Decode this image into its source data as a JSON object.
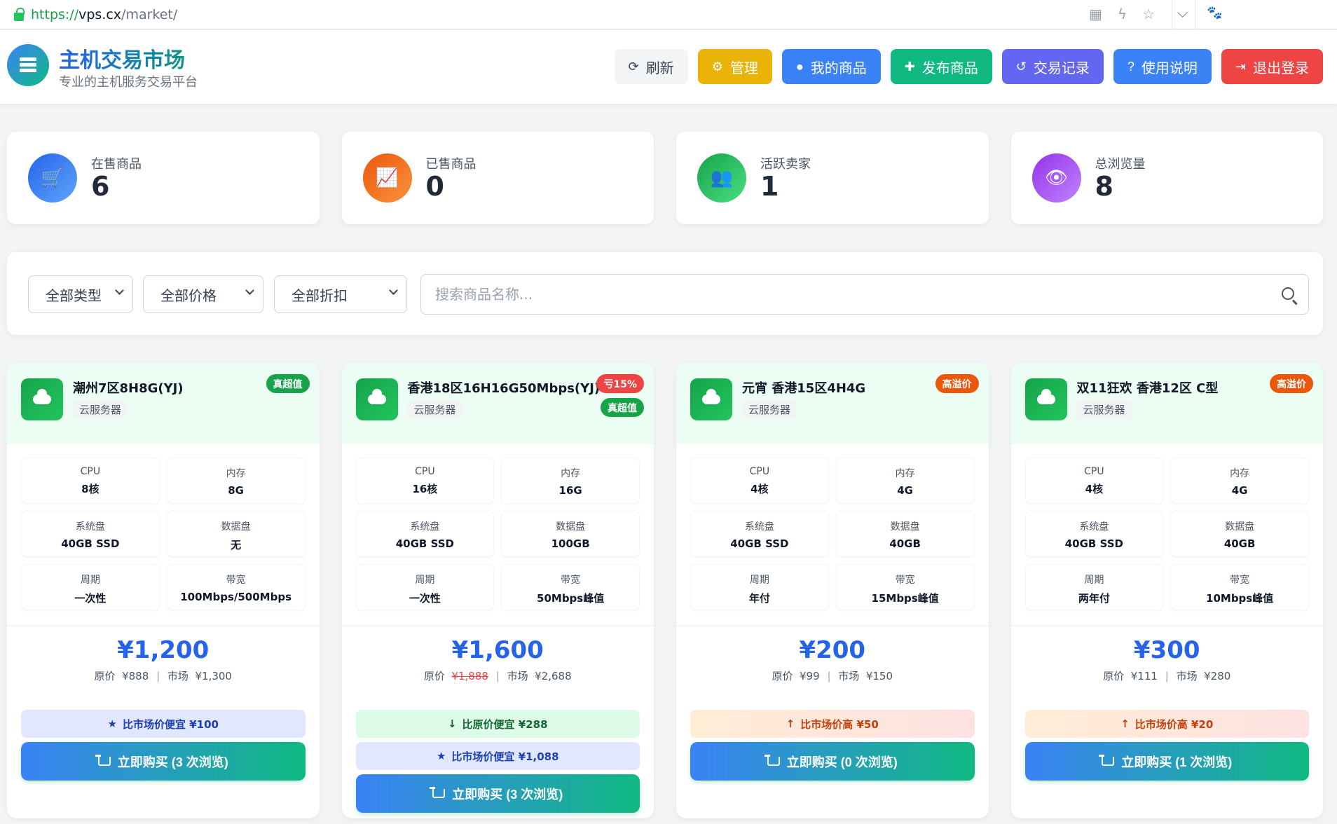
{
  "browser": {
    "url_protocol": "https://",
    "url_host": "vps.cx",
    "url_path": "/market/"
  },
  "header": {
    "title": "主机交易市场",
    "subtitle": "专业的主机服务交易平台",
    "nav": [
      {
        "label": "刷新",
        "icon": "refresh-icon",
        "color": "#f3f4f6"
      },
      {
        "label": "管理",
        "icon": "gear-icon",
        "color": "#eab308"
      },
      {
        "label": "我的商品",
        "icon": "user-icon",
        "color": "#3b82f6"
      },
      {
        "label": "发布商品",
        "icon": "plus-icon",
        "color": "#10b981"
      },
      {
        "label": "交易记录",
        "icon": "history-icon",
        "color": "#6366f1"
      },
      {
        "label": "使用说明",
        "icon": "question-icon",
        "color": "#3b82f6"
      },
      {
        "label": "退出登录",
        "icon": "logout-icon",
        "color": "#ef4444"
      }
    ]
  },
  "stats": [
    {
      "label": "在售商品",
      "value": "6",
      "icon": "cart-icon"
    },
    {
      "label": "已售商品",
      "value": "0",
      "icon": "chart-icon"
    },
    {
      "label": "活跃卖家",
      "value": "1",
      "icon": "users-icon"
    },
    {
      "label": "总浏览量",
      "value": "8",
      "icon": "eye-icon"
    }
  ],
  "filters": {
    "type": "全部类型",
    "price": "全部价格",
    "discount": "全部折扣",
    "search_placeholder": "搜索商品名称..."
  },
  "products": [
    {
      "title": "潮州7区8H8G(YJ)",
      "type": "云服务器",
      "badges": [
        {
          "text": "真超值",
          "color": "#16a34a"
        }
      ],
      "specs": [
        {
          "label": "CPU",
          "value": "8核"
        },
        {
          "label": "内存",
          "value": "8G"
        },
        {
          "label": "系统盘",
          "value": "40GB SSD"
        },
        {
          "label": "数据盘",
          "value": "无"
        },
        {
          "label": "周期",
          "value": "一次性"
        },
        {
          "label": "带宽",
          "value": "100Mbps/500Mbps"
        }
      ],
      "price": "¥1,200",
      "original_label": "原价",
      "original": "¥888",
      "original_struck": false,
      "market_label": "市场",
      "market": "¥1,300",
      "compares": [
        {
          "text": "比市场价便宜 ¥100",
          "icon": "star-icon",
          "style": "blue"
        }
      ],
      "buy_label": "立即购买 (3 次浏览)"
    },
    {
      "title": "香港18区16H16G50Mbps(YJ)",
      "type": "云服务器",
      "badges": [
        {
          "text": "亏15%",
          "color": "#ef4444"
        },
        {
          "text": "真超值",
          "color": "#16a34a"
        }
      ],
      "specs": [
        {
          "label": "CPU",
          "value": "16核"
        },
        {
          "label": "内存",
          "value": "16G"
        },
        {
          "label": "系统盘",
          "value": "40GB SSD"
        },
        {
          "label": "数据盘",
          "value": "100GB"
        },
        {
          "label": "周期",
          "value": "一次性"
        },
        {
          "label": "带宽",
          "value": "50Mbps峰值"
        }
      ],
      "price": "¥1,600",
      "original_label": "原价",
      "original": "¥1,888",
      "original_struck": true,
      "market_label": "市场",
      "market": "¥2,688",
      "compares": [
        {
          "text": "比原价便宜 ¥288",
          "icon": "arrow-down-icon",
          "style": "green"
        },
        {
          "text": "比市场价便宜 ¥1,088",
          "icon": "star-icon",
          "style": "blue"
        }
      ],
      "buy_label": "立即购买 (3 次浏览)"
    },
    {
      "title": "元宵 香港15区4H4G",
      "type": "云服务器",
      "badges": [
        {
          "text": "高溢价",
          "color": "#ea580c"
        }
      ],
      "specs": [
        {
          "label": "CPU",
          "value": "4核"
        },
        {
          "label": "内存",
          "value": "4G"
        },
        {
          "label": "系统盘",
          "value": "40GB SSD"
        },
        {
          "label": "数据盘",
          "value": "40GB"
        },
        {
          "label": "周期",
          "value": "年付"
        },
        {
          "label": "带宽",
          "value": "15Mbps峰值"
        }
      ],
      "price": "¥200",
      "original_label": "原价",
      "original": "¥99",
      "original_struck": false,
      "market_label": "市场",
      "market": "¥150",
      "compares": [
        {
          "text": "比市场价高 ¥50",
          "icon": "arrow-up-icon",
          "style": "orange"
        }
      ],
      "buy_label": "立即购买 (0 次浏览)"
    },
    {
      "title": "双11狂欢 香港12区 C型",
      "type": "云服务器",
      "badges": [
        {
          "text": "高溢价",
          "color": "#ea580c"
        }
      ],
      "specs": [
        {
          "label": "CPU",
          "value": "4核"
        },
        {
          "label": "内存",
          "value": "4G"
        },
        {
          "label": "系统盘",
          "value": "40GB SSD"
        },
        {
          "label": "数据盘",
          "value": "40GB"
        },
        {
          "label": "周期",
          "value": "两年付"
        },
        {
          "label": "带宽",
          "value": "10Mbps峰值"
        }
      ],
      "price": "¥300",
      "original_label": "原价",
      "original": "¥111",
      "original_struck": false,
      "market_label": "市场",
      "market": "¥280",
      "compares": [
        {
          "text": "比市场价高 ¥20",
          "icon": "arrow-up-icon",
          "style": "orange"
        }
      ],
      "buy_label": "立即购买 (1 次浏览)"
    }
  ]
}
